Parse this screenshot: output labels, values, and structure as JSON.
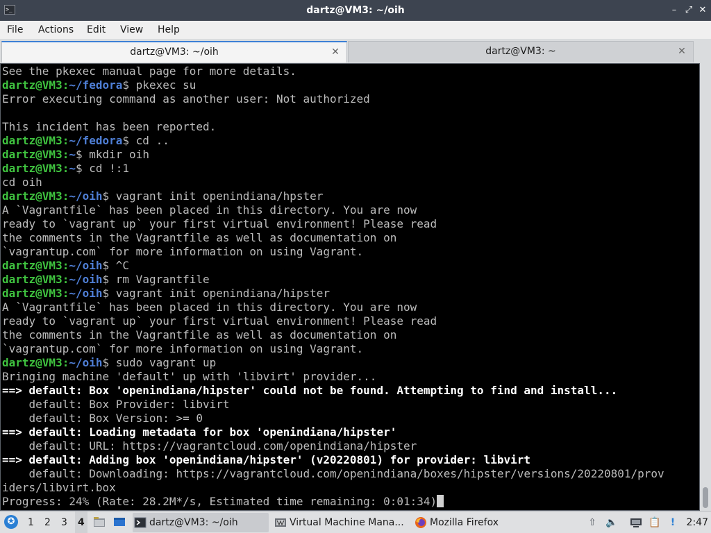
{
  "window": {
    "title": "dartz@VM3: ~/oih",
    "controls": {
      "minimize": "–",
      "maximize": "⤢",
      "close": "✕"
    }
  },
  "menu": [
    "File",
    "Actions",
    "Edit",
    "View",
    "Help"
  ],
  "tabs": [
    {
      "label": "dartz@VM3: ~/oih",
      "active": true
    },
    {
      "label": "dartz@VM3: ~",
      "active": false
    }
  ],
  "terminal": {
    "lines": [
      {
        "out": "See the pkexec manual page for more details."
      },
      {
        "user": "dartz@VM3",
        "path": "~/fedora",
        "cmd": "$ pkexec su"
      },
      {
        "out": "Error executing command as another user: Not authorized"
      },
      {
        "out": ""
      },
      {
        "out": "This incident has been reported."
      },
      {
        "user": "dartz@VM3",
        "path": "~/fedora",
        "cmd": "$ cd .."
      },
      {
        "user": "dartz@VM3",
        "path": "~",
        "cmd": "$ mkdir oih"
      },
      {
        "user": "dartz@VM3",
        "path": "~",
        "cmd": "$ cd !:1"
      },
      {
        "out": "cd oih"
      },
      {
        "user": "dartz@VM3",
        "path": "~/oih",
        "cmd": "$ vagrant init openindiana/hpster"
      },
      {
        "out": "A `Vagrantfile` has been placed in this directory. You are now"
      },
      {
        "out": "ready to `vagrant up` your first virtual environment! Please read"
      },
      {
        "out": "the comments in the Vagrantfile as well as documentation on"
      },
      {
        "out": "`vagrantup.com` for more information on using Vagrant."
      },
      {
        "user": "dartz@VM3",
        "path": "~/oih",
        "cmd": "$ ^C"
      },
      {
        "user": "dartz@VM3",
        "path": "~/oih",
        "cmd": "$ rm Vagrantfile"
      },
      {
        "user": "dartz@VM3",
        "path": "~/oih",
        "cmd": "$ vagrant init openindiana/hipster"
      },
      {
        "out": "A `Vagrantfile` has been placed in this directory. You are now"
      },
      {
        "out": "ready to `vagrant up` your first virtual environment! Please read"
      },
      {
        "out": "the comments in the Vagrantfile as well as documentation on"
      },
      {
        "out": "`vagrantup.com` for more information on using Vagrant."
      },
      {
        "user": "dartz@VM3",
        "path": "~/oih",
        "cmd": "$ sudo vagrant up"
      },
      {
        "out": "Bringing machine 'default' up with 'libvirt' provider..."
      },
      {
        "out": "==> default: Box 'openindiana/hipster' could not be found. Attempting to find and install...",
        "bold": true
      },
      {
        "out": "    default: Box Provider: libvirt"
      },
      {
        "out": "    default: Box Version: >= 0"
      },
      {
        "out": "==> default: Loading metadata for box 'openindiana/hipster'",
        "bold": true
      },
      {
        "out": "    default: URL: https://vagrantcloud.com/openindiana/hipster"
      },
      {
        "out": "==> default: Adding box 'openindiana/hipster' (v20220801) for provider: libvirt",
        "bold": true
      },
      {
        "out": "    default: Downloading: https://vagrantcloud.com/openindiana/boxes/hipster/versions/20220801/prov"
      },
      {
        "out": "iders/libvirt.box"
      },
      {
        "out": "Progress: 24% (Rate: 28.2M*/s, Estimated time remaining: 0:01:34)",
        "cursor": true
      }
    ]
  },
  "taskbar": {
    "start_icon": "✪",
    "workspaces": [
      "1",
      "2",
      "3",
      "4"
    ],
    "active_workspace": "4",
    "tasks": [
      {
        "label": "dartz@VM3: ~/oih",
        "icon": "terminal-icon",
        "active": true
      },
      {
        "label": "Virtual Machine Mana...",
        "icon": "virt-manager-icon",
        "active": false
      },
      {
        "label": "Mozilla Firefox",
        "icon": "firefox-icon",
        "active": false
      }
    ],
    "tray": {
      "upload": "⇧",
      "volume": "🔈",
      "clipboard": "📋",
      "notes": "🗒",
      "updates": "!"
    },
    "clock": "2:47"
  }
}
